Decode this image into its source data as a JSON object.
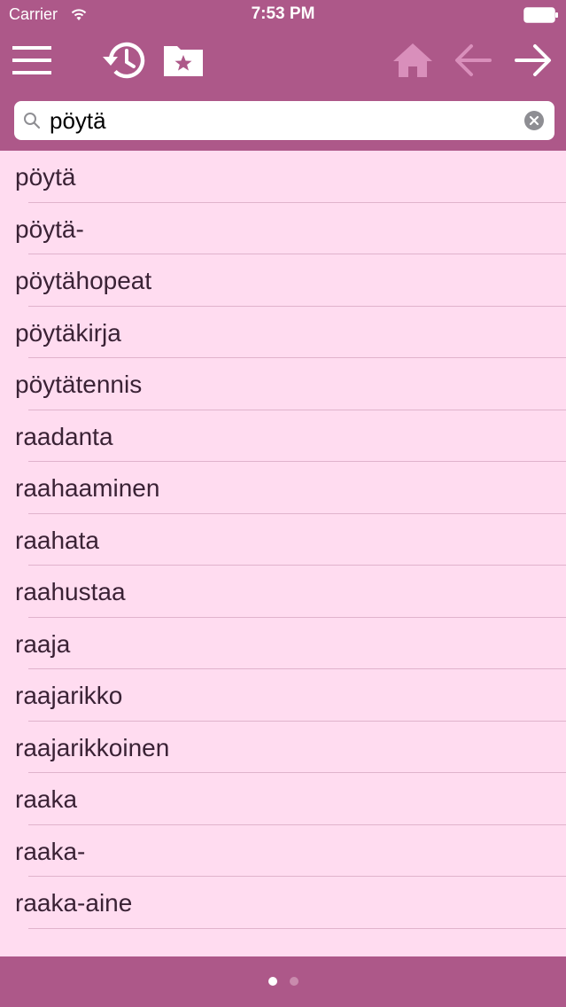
{
  "status_bar": {
    "carrier": "Carrier",
    "time": "7:53 PM"
  },
  "toolbar": {
    "icons": [
      "menu-icon",
      "history-icon",
      "favorites-folder-icon",
      "home-icon",
      "back-arrow-icon",
      "forward-arrow-icon"
    ]
  },
  "search": {
    "value": "pöytä",
    "placeholder": ""
  },
  "words": [
    "pöytä",
    "pöytä-",
    "pöytähopeat",
    "pöytäkirja",
    "pöytätennis",
    "raadanta",
    "raahaaminen",
    "raahata",
    "raahustaa",
    "raaja",
    "raajarikko",
    "raajarikkoinen",
    "raaka",
    "raaka-",
    "raaka-aine"
  ],
  "pagination": {
    "pages": 2,
    "current": 1
  },
  "colors": {
    "bar": "#ad5889",
    "list_background": "#ffdcf0",
    "text": "#3a2235"
  }
}
